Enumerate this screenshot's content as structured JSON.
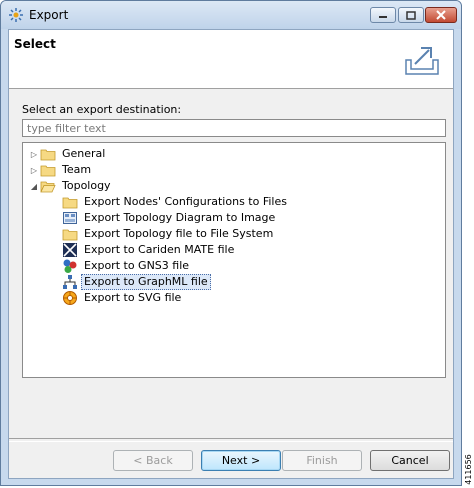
{
  "window": {
    "title": "Export",
    "icon": "export-app-icon"
  },
  "header": {
    "title": "Select",
    "icon": "export-tray-icon"
  },
  "prompt": {
    "label": "Select an export destination:"
  },
  "filter": {
    "placeholder": "type filter text",
    "value": ""
  },
  "tree": {
    "folders": [
      {
        "label": "General",
        "expanded": false
      },
      {
        "label": "Team",
        "expanded": false
      },
      {
        "label": "Topology",
        "expanded": true
      }
    ],
    "topology_items": [
      {
        "label": "Export Nodes' Configurations to Files",
        "icon": "folder-icon"
      },
      {
        "label": "Export Topology Diagram to Image",
        "icon": "image-icon"
      },
      {
        "label": "Export Topology file to File System",
        "icon": "folder-icon"
      },
      {
        "label": "Export to Cariden MATE file",
        "icon": "cariden-icon"
      },
      {
        "label": "Export to GNS3 file",
        "icon": "gns3-icon"
      },
      {
        "label": "Export to GraphML file",
        "icon": "graphml-icon",
        "selected": true
      },
      {
        "label": "Export to SVG file",
        "icon": "svg-icon"
      }
    ]
  },
  "buttons": {
    "back": "< Back",
    "next": "Next >",
    "finish": "Finish",
    "cancel": "Cancel"
  },
  "figure_id": "411656",
  "colors": {
    "titlebar": "#c7d9ed",
    "selection": "#dce8f8",
    "default_button": "#3c7fb1"
  }
}
